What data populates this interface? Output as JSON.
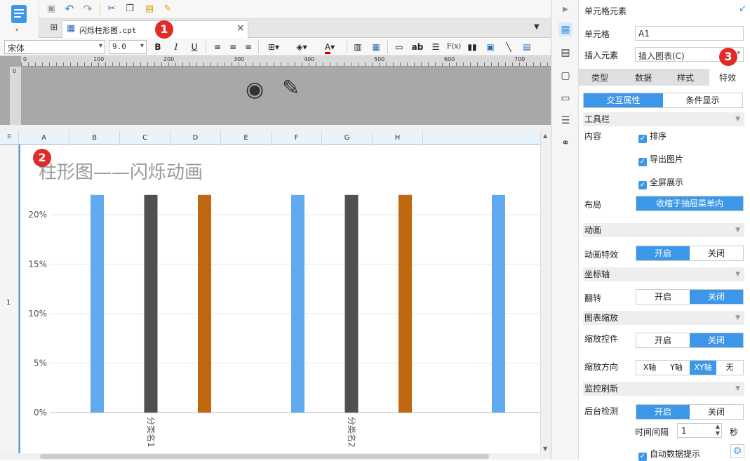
{
  "toolbar": {
    "icons": [
      "save-icon",
      "undo-icon",
      "redo-icon",
      "cut-icon",
      "copy-icon",
      "paste-icon",
      "format-brush-icon"
    ]
  },
  "tab": {
    "title": "闪烁柱形图.cpt",
    "close": "×"
  },
  "format": {
    "font_name": "宋体",
    "font_size": "9.0",
    "bold": "B",
    "italic": "I",
    "underline": "U",
    "fx": "F(x)",
    "ab": "ab"
  },
  "ruler": {
    "ticks": [
      "0",
      "100",
      "200",
      "300",
      "400",
      "500",
      "600",
      "700"
    ],
    "vertical_tick": "0"
  },
  "sheet": {
    "columns": [
      "A",
      "B",
      "C",
      "D",
      "E",
      "F",
      "G",
      "H"
    ],
    "row_number": "1"
  },
  "chart_data": {
    "type": "bar",
    "title": "柱形图——闪烁动画",
    "categories": [
      "分类名1",
      "分类名2"
    ],
    "y_ticks": [
      "20%",
      "15%",
      "10%",
      "5%",
      "0%"
    ],
    "ylim": [
      0,
      0.22
    ],
    "bars": [
      {
        "category_index": 0,
        "color": "#62aaf0",
        "value": 0.22
      },
      {
        "category_index": 0,
        "color": "#505050",
        "value": 0.22
      },
      {
        "category_index": 0,
        "color": "#c0680f",
        "value": 0.22
      },
      {
        "category_index": 1,
        "color": "#62aaf0",
        "value": 0.22
      },
      {
        "category_index": 1,
        "color": "#505050",
        "value": 0.22
      },
      {
        "category_index": 1,
        "color": "#c0680f",
        "value": 0.22
      },
      {
        "category_index": 2,
        "color": "#62aaf0",
        "value": 0.22
      }
    ]
  },
  "panel": {
    "title": "单元格元素",
    "cell_label": "单元格",
    "cell_value": "A1",
    "insert_label": "插入元素",
    "insert_value": "插入图表(C)",
    "tabs": [
      "类型",
      "数据",
      "样式",
      "特效"
    ],
    "subtabs": [
      "交互属性",
      "条件显示"
    ],
    "toolbar_section": "工具栏",
    "content_label": "内容",
    "checks": [
      "排序",
      "导出图片",
      "全屏展示"
    ],
    "layout_label": "布局",
    "layout_value": "收缩于抽屉菜单内",
    "animation_section": "动画",
    "anim_effect_label": "动画特效",
    "axis_section": "坐标轴",
    "flip_label": "翻转",
    "zoom_section": "图表缩放",
    "zoom_ctrl_label": "缩放控件",
    "zoom_dir_label": "缩放方向",
    "zoom_dir_options": [
      "X轴",
      "Y轴",
      "XY轴",
      "无"
    ],
    "monitor_section": "监控刷新",
    "backend_label": "后台检测",
    "interval_label": "时间间隔",
    "interval_value": "1",
    "interval_unit": "秒",
    "auto_tip": "自动数据提示",
    "on": "开启",
    "off": "关闭"
  },
  "badges": [
    "1",
    "2",
    "3"
  ]
}
